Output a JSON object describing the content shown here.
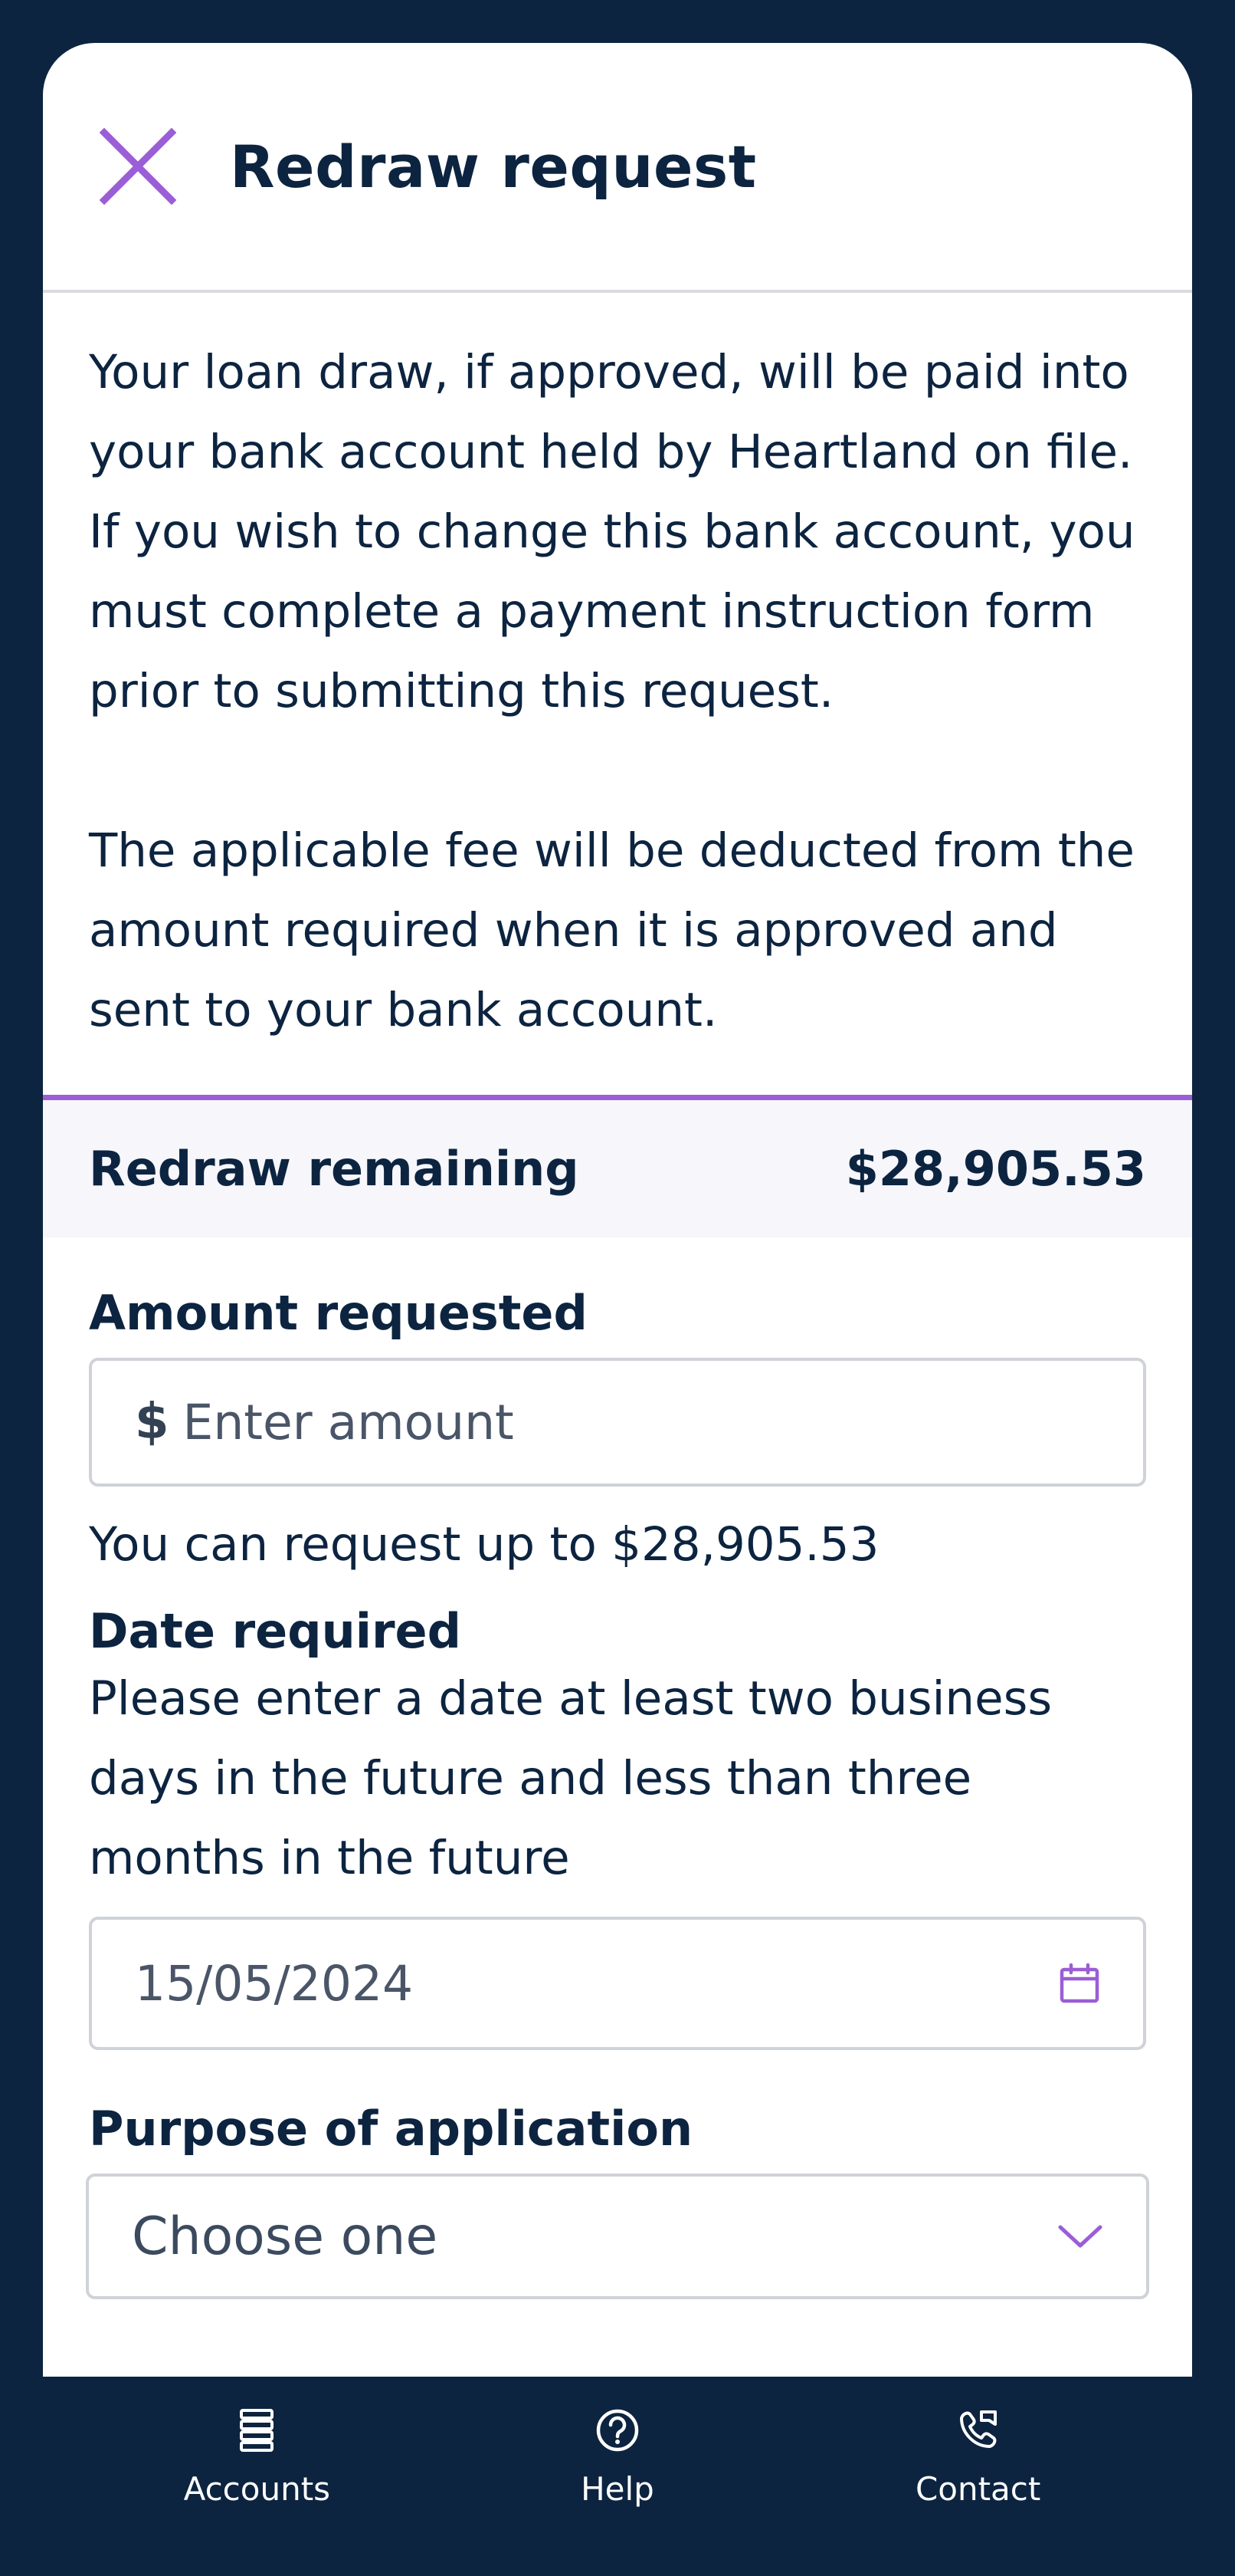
{
  "header": {
    "title": "Redraw request"
  },
  "intro": {
    "paragraph1": "Your loan draw, if approved, will be paid into your bank account held by Heartland on file. If you wish to change this bank account, you must complete a payment instruction form prior to submitting this request.",
    "paragraph2": "The applicable fee will be deducted from the amount required when it is approved and sent to your bank account."
  },
  "remaining": {
    "label": "Redraw remaining",
    "value": "$28,905.53"
  },
  "form": {
    "amount": {
      "label": "Amount requested",
      "currency_symbol": "$",
      "placeholder": "Enter amount",
      "value": "",
      "helper": "You can request up to $28,905.53"
    },
    "date": {
      "label": "Date required",
      "description": "Please enter a date at least two business days in the future and less than three months in the future",
      "value": "15/05/2024",
      "icon": "calendar-icon"
    },
    "purpose": {
      "label": "Purpose of application",
      "selected": "Choose one",
      "icon": "chevron-down-icon"
    }
  },
  "nav": {
    "items": [
      {
        "label": "Accounts",
        "icon": "accounts-icon"
      },
      {
        "label": "Help",
        "icon": "help-icon"
      },
      {
        "label": "Contact",
        "icon": "phone-icon"
      }
    ]
  },
  "colors": {
    "navy": "#0c2440",
    "accent": "#9b5ed6",
    "panel": "#f6f6fb",
    "border": "#cfd2d8"
  }
}
